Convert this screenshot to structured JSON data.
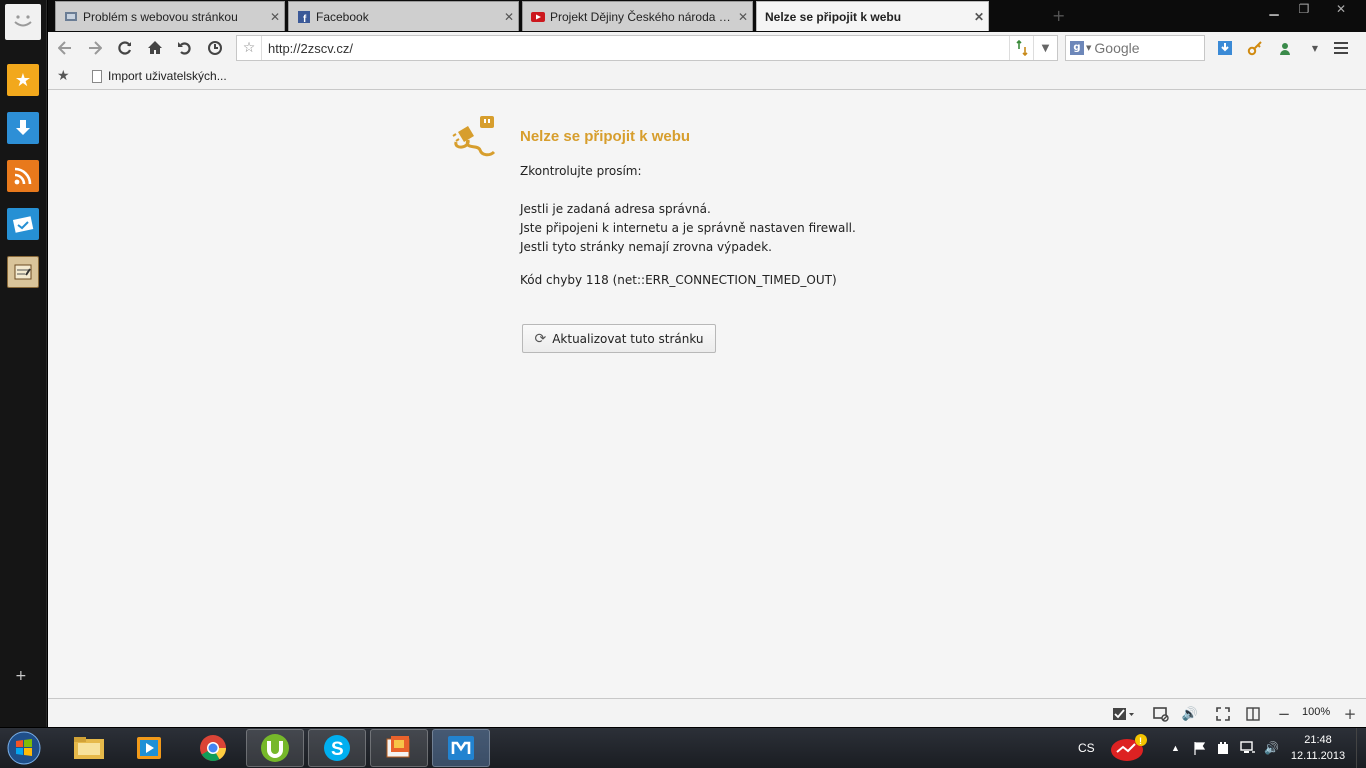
{
  "browser": {
    "tabs": [
      {
        "label": "Problém s webovou stránkou",
        "icon": "page-icon",
        "active": false
      },
      {
        "label": "Facebook",
        "icon": "facebook-icon",
        "active": false
      },
      {
        "label": "Projekt Dějiny Českého národa p...",
        "icon": "youtube-icon",
        "active": false
      },
      {
        "label": "Nelze se připojit k webu",
        "icon": "none",
        "active": true
      }
    ],
    "new_tab_symbol": "+",
    "url": "http://2zscv.cz/",
    "search_placeholder": "Google",
    "search_engine_letter": "g"
  },
  "bookmarks": {
    "items": [
      {
        "label": "Import uživatelských..."
      }
    ]
  },
  "error_page": {
    "title": "Nelze se připojit k webu",
    "check_label": "Zkontrolujte prosím:",
    "checks": [
      "Jestli je zadaná adresa správná.",
      "Jste připojeni k internetu a je správně nastaven firewall.",
      "Jestli tyto stránky nemají zrovna výpadek."
    ],
    "error_code": "Kód chyby 118 (net::ERR_CONNECTION_TIMED_OUT)",
    "reload_label": "Aktualizovat tuto stránku",
    "accent_color": "#d79e2d"
  },
  "statusbar": {
    "zoom": "100%",
    "zoom_minus": "−",
    "zoom_plus": "+"
  },
  "taskbar": {
    "language": "CS",
    "time": "21:48",
    "date": "12.11.2013"
  },
  "sidebar": {
    "add_symbol": "+"
  }
}
